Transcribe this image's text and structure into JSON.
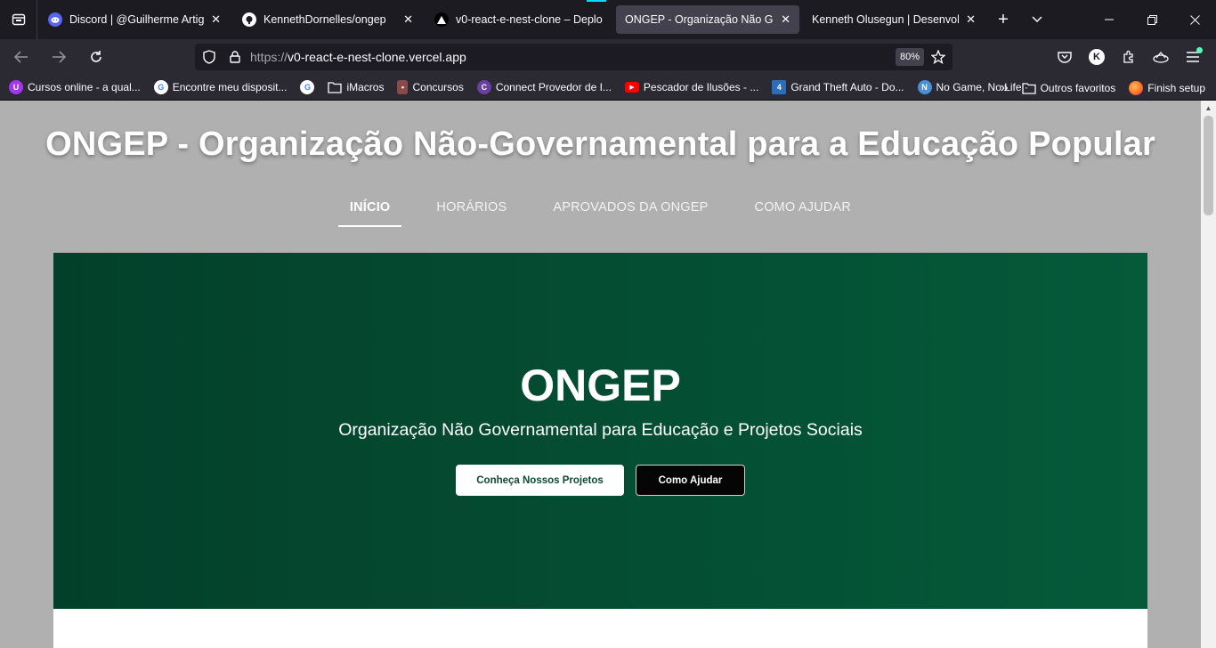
{
  "browser": {
    "tabs": [
      {
        "title": "Discord | @Guilherme Artigas",
        "icon": "discord-icon",
        "color": "#5865f2",
        "active": false
      },
      {
        "title": "KennethDornelles/ongep",
        "icon": "github-icon",
        "color": "#ffffff",
        "active": false
      },
      {
        "title": "v0-react-e-nest-clone – Deplo",
        "icon": "vercel-icon",
        "color": "#000000",
        "active": false
      },
      {
        "title": "ONGEP - Organização Não Gover",
        "icon": "",
        "color": "",
        "active": true
      },
      {
        "title": "Kenneth Olusegun | Desenvolved",
        "icon": "",
        "color": "",
        "active": false
      }
    ],
    "url_scheme": "https://",
    "url_host": "v0-react-e-nest-clone.vercel.app",
    "zoom": "80%",
    "bookmarks": [
      {
        "label": "Cursos online - a qual...",
        "icon": "udemy-icon",
        "color": "#a435f0"
      },
      {
        "label": "Encontre meu disposit...",
        "icon": "google-icon",
        "color": "#4285f4"
      },
      {
        "label": "",
        "icon": "google-icon",
        "color": "#4285f4"
      },
      {
        "label": "iMacros",
        "icon": "folder-icon",
        "color": ""
      },
      {
        "label": "Concursos",
        "icon": "concursos-icon",
        "color": "#c27070"
      },
      {
        "label": "Connect Provedor de I...",
        "icon": "connect-icon",
        "color": "#6b3fa0"
      },
      {
        "label": "Pescador de Ilusões - ...",
        "icon": "youtube-icon",
        "color": "#ff0000"
      },
      {
        "label": "Grand Theft Auto - Do...",
        "icon": "gta-icon",
        "color": "#2a6ebb"
      },
      {
        "label": "No Game, No Life ·",
        "icon": "ngnl-icon",
        "color": "#4a90d9"
      }
    ],
    "bookmarks_overflow": "»",
    "bookmarks_other": "Outros favoritos",
    "bookmarks_setup": "Finish setup"
  },
  "site": {
    "title": "ONGEP - Organização Não-Governamental para a Educação Popular",
    "nav": [
      "INÍCIO",
      "HORÁRIOS",
      "APROVADOS DA ONGEP",
      "COMO AJUDAR"
    ],
    "hero": {
      "title": "ONGEP",
      "subtitle": "Organização Não Governamental para Educação e Projetos Sociais",
      "primary_button": "Conheça Nossos Projetos",
      "secondary_button": "Como Ajudar"
    }
  },
  "colors": {
    "hero_start": "#03402a",
    "hero_end": "#055a3a",
    "page_overlay": "#b0b0b0"
  }
}
